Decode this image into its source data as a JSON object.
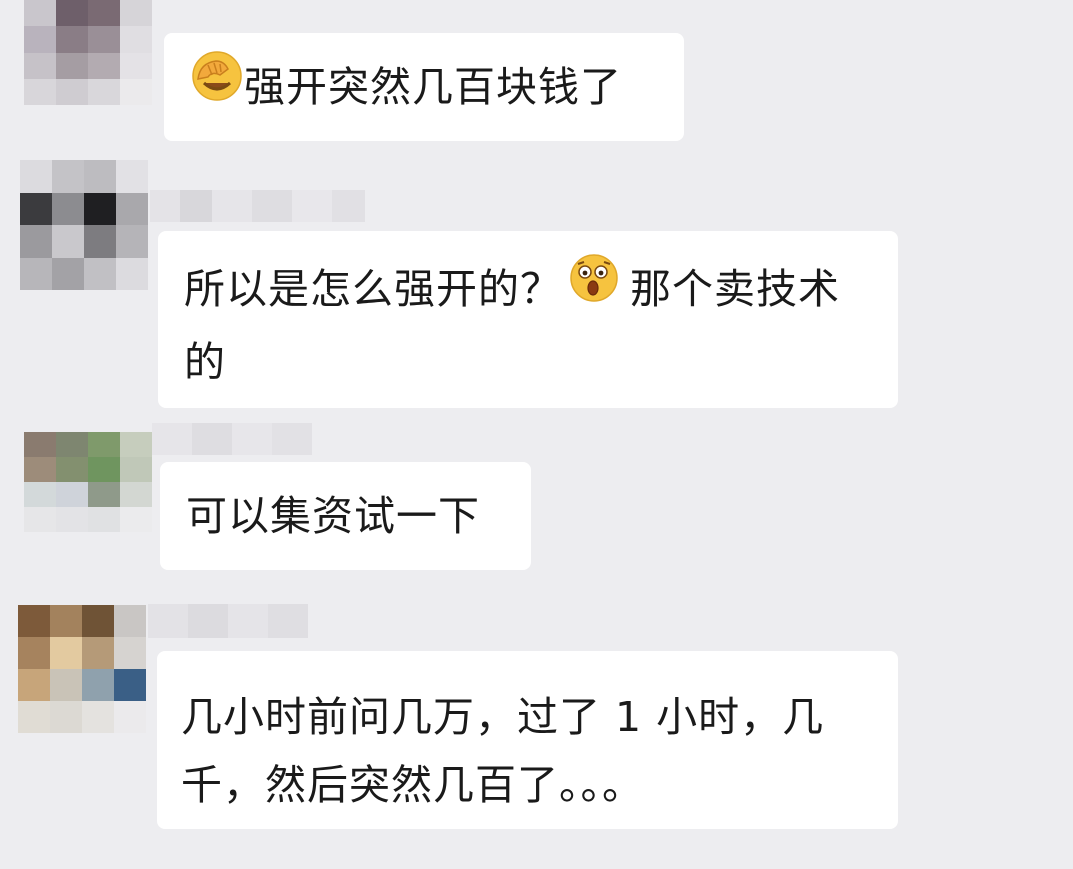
{
  "chat": {
    "messages": [
      {
        "sender": "",
        "emoji": "facepalm-emoji",
        "text": "强开突然几百块钱了",
        "avatar_colors": [
          "#c9c6cc",
          "#6e5f6a",
          "#7a6a73",
          "#d6d4d8",
          "#b9b3bd",
          "#8a7d86",
          "#9a8f97",
          "#e0dee2",
          "#c6c2c8",
          "#a59da3",
          "#b3abb1",
          "#e4e2e6",
          "#d8d6da",
          "#cfccd1",
          "#d9d7db",
          "#ebeaec"
        ]
      },
      {
        "sender": "",
        "text_before": "所以是怎么强开的？",
        "emoji": "shocked-emoji",
        "text_after": "那个卖技术的",
        "avatar_colors": [
          "#dcdbdf",
          "#c4c3c7",
          "#bdbcc0",
          "#e2e1e5",
          "#3b3b3e",
          "#8c8c90",
          "#1f1f22",
          "#a9a8ac",
          "#9b9a9e",
          "#c9c8cc",
          "#7d7c80",
          "#b5b4b8",
          "#b7b6ba",
          "#a3a2a6",
          "#c1c0c4",
          "#dcdbdf"
        ]
      },
      {
        "sender": "",
        "text": "可以集资试一下",
        "avatar_colors": [
          "#8a7b6f",
          "#7e8670",
          "#7f9a6b",
          "#c6cdbd",
          "#9d8c7a",
          "#83906f",
          "#6f955f",
          "#c0c8b8",
          "#d3d9da",
          "#cfd3da",
          "#8f9a8a",
          "#d3d7d2",
          "#e6e6e8",
          "#e3e3e6",
          "#e0e1e3",
          "#ebebed"
        ]
      },
      {
        "sender": "",
        "text": "几小时前问几万，过了 1 小时，几千，然后突然几百了。。。",
        "avatar_colors": [
          "#7d5a3a",
          "#a3825d",
          "#6f5336",
          "#c9c6c4",
          "#a6835e",
          "#e3caa0",
          "#b59a78",
          "#d6d3d0",
          "#c7a57a",
          "#c9c3b7",
          "#8fa1ad",
          "#3a5f86",
          "#e0dcd4",
          "#dcd9d3",
          "#e4e2df",
          "#ebeaec"
        ]
      }
    ]
  },
  "colors": {
    "background": "#ededf0",
    "bubble": "#ffffff",
    "text": "#1a1a1a",
    "emoji_yellow": "#f6c33f",
    "emoji_hand": "#f2a93c"
  }
}
